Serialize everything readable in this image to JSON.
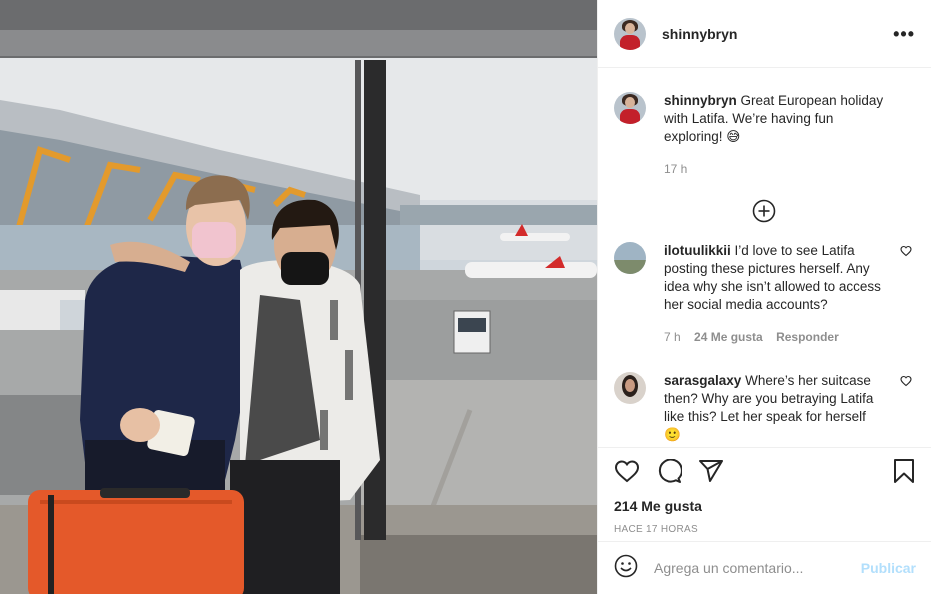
{
  "header": {
    "username": "shinnybryn",
    "more_label": "•••"
  },
  "caption": {
    "username": "shinnybryn",
    "text": "Great European holiday with Latifa. We’re having fun exploring! 😅",
    "time": "17 h"
  },
  "comments": [
    {
      "username": "ilotuulikkii",
      "text": "I’d love to see Latifa posting these pictures herself. Any idea why she isn’t allowed to access her social media accounts?",
      "time": "7 h",
      "likes": "24 Me gusta",
      "reply": "Responder"
    },
    {
      "username": "sarasgalaxy",
      "text": "Where’s her suitcase then? Why are you betraying Latifa like this? Let her speak for herself 🙂"
    }
  ],
  "actions": {
    "icons": [
      "heart-icon",
      "comment-icon",
      "share-icon",
      "bookmark-icon"
    ],
    "likes": "214 Me gusta",
    "time_ago": "HACE 17 HORAS"
  },
  "add_comment": {
    "placeholder": "Agrega un comentario...",
    "publish": "Publicar"
  },
  "colors": {
    "text": "#262626",
    "secondary": "#8e8e8e",
    "publish_disabled": "#b2dffc",
    "border": "#efefef"
  }
}
